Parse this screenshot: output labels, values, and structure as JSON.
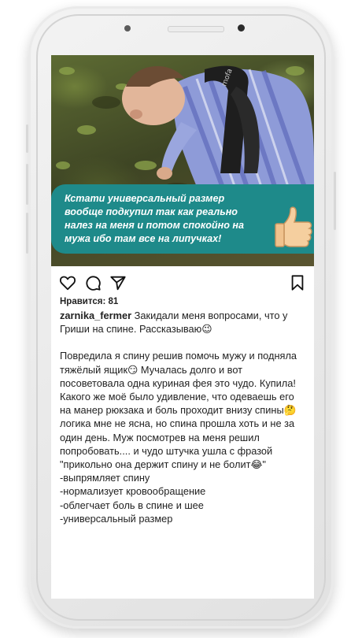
{
  "overlay": {
    "speech_text": "Кстати универсальный размер вообще подкупил так как реально налез на меня и потом спокойно на мужа ибо там все на липучках!",
    "brand_on_strap": "mofa"
  },
  "icons": {
    "like": "heart-icon",
    "comment": "comment-bubble-icon",
    "share": "paper-plane-icon",
    "save": "bookmark-icon"
  },
  "post": {
    "likes": "Нравится: 81",
    "username": "zarnika_fermer",
    "intro": " Закидали меня вопросами, что у Гриши на спине. Рассказываю😉",
    "body": "Повредила я спину решив помочь мужу и подняла тяжёлый ящик😏 Мучалась долго и вот посоветовала одна куриная фея это чудо. Купила! Какого же моё было удивление, что одеваешь его на манер рюкзака и боль проходит внизу спины🤔 логика мне не ясна, но спина прошла хоть и не за один день. Муж посмотрев на меня решил попробовать.... и чудо штучка ушла с фразой \"прикольно она держит спину и не болит😂\"",
    "list": [
      "-выпрямляет спину",
      "-нормализует кровообращение",
      "-облегчает боль в спине и шее",
      "-универсальный размер"
    ]
  }
}
